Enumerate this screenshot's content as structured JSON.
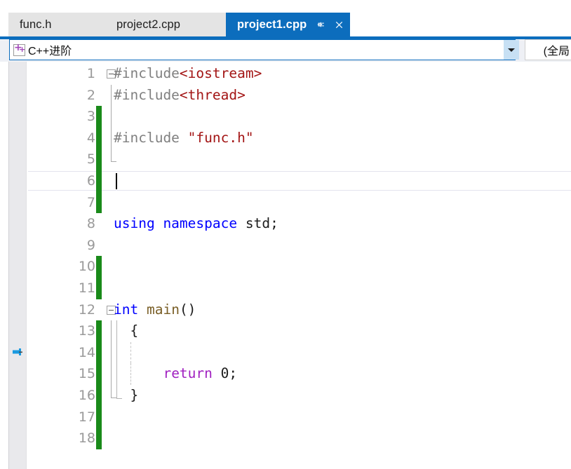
{
  "window": {
    "app": "Visual Studio",
    "accent_color": "#0c6dbd"
  },
  "tabs": [
    {
      "label": "func.h",
      "active": false,
      "name": "tab-func-h"
    },
    {
      "label": "project2.cpp",
      "active": false,
      "name": "tab-project2-cpp"
    },
    {
      "label": "project1.cpp",
      "active": true,
      "name": "tab-project1-cpp"
    }
  ],
  "tab_controls": {
    "pin_icon": "pin-icon",
    "close_icon": "close-icon"
  },
  "nav_bar": {
    "project_icon": "cpp-project-icon",
    "project_value": "C++进阶",
    "dropdown_icon": "chevron-down-icon",
    "scope_value": "(全局"
  },
  "editor": {
    "language": "cpp",
    "current_line": 6,
    "bookmark_line": 14,
    "bookmark_icon": "bookmark-pin-icon",
    "colors": {
      "preprocessor": "#808080",
      "string": "#a31515",
      "keyword": "#0000ff",
      "function": "#795e26",
      "control": "#a020c0",
      "plain": "#1b1b1b",
      "change_bar": "#1a8a1a",
      "line_number": "#9a9a9a"
    },
    "lines": [
      {
        "n": 1,
        "changed": false,
        "collapse": "open",
        "outline": "none",
        "tokens": [
          {
            "t": "#include",
            "c": "pre"
          },
          {
            "t": "<iostream>",
            "c": "str"
          }
        ]
      },
      {
        "n": 2,
        "changed": false,
        "collapse": "none",
        "outline": "v",
        "tokens": [
          {
            "t": "#include",
            "c": "pre"
          },
          {
            "t": "<thread>",
            "c": "str"
          }
        ]
      },
      {
        "n": 3,
        "changed": true,
        "collapse": "none",
        "outline": "v",
        "tokens": []
      },
      {
        "n": 4,
        "changed": true,
        "collapse": "none",
        "outline": "v",
        "tokens": [
          {
            "t": "#include ",
            "c": "pre"
          },
          {
            "t": "\"func.h\"",
            "c": "str"
          }
        ]
      },
      {
        "n": 5,
        "changed": true,
        "collapse": "none",
        "outline": "end",
        "tokens": []
      },
      {
        "n": 6,
        "changed": true,
        "collapse": "none",
        "outline": "none",
        "tokens": []
      },
      {
        "n": 7,
        "changed": true,
        "collapse": "none",
        "outline": "none",
        "tokens": []
      },
      {
        "n": 8,
        "changed": false,
        "collapse": "none",
        "outline": "none",
        "tokens": [
          {
            "t": "using namespace ",
            "c": "key"
          },
          {
            "t": "std;",
            "c": "plain"
          }
        ]
      },
      {
        "n": 9,
        "changed": false,
        "collapse": "none",
        "outline": "none",
        "tokens": []
      },
      {
        "n": 10,
        "changed": true,
        "collapse": "none",
        "outline": "none",
        "tokens": []
      },
      {
        "n": 11,
        "changed": true,
        "collapse": "none",
        "outline": "none",
        "tokens": []
      },
      {
        "n": 12,
        "changed": false,
        "collapse": "open",
        "outline": "none",
        "tokens": [
          {
            "t": "int ",
            "c": "key"
          },
          {
            "t": "main",
            "c": "fn"
          },
          {
            "t": "()",
            "c": "plain"
          }
        ]
      },
      {
        "n": 13,
        "changed": true,
        "collapse": "none",
        "outline": "v",
        "brace": "v",
        "tokens": [
          {
            "t": "  {",
            "c": "plain"
          }
        ]
      },
      {
        "n": 14,
        "changed": true,
        "collapse": "none",
        "outline": "v",
        "brace": "v",
        "indent": true,
        "tokens": []
      },
      {
        "n": 15,
        "changed": true,
        "collapse": "none",
        "outline": "v",
        "brace": "v",
        "indent": true,
        "tokens": [
          {
            "t": "      ",
            "c": "plain"
          },
          {
            "t": "return ",
            "c": "ctl"
          },
          {
            "t": "0;",
            "c": "plain"
          }
        ]
      },
      {
        "n": 16,
        "changed": true,
        "collapse": "none",
        "outline": "end",
        "brace": "end",
        "tokens": [
          {
            "t": "  }",
            "c": "plain"
          }
        ]
      },
      {
        "n": 17,
        "changed": true,
        "collapse": "none",
        "outline": "none",
        "tokens": []
      },
      {
        "n": 18,
        "changed": true,
        "collapse": "none",
        "outline": "none",
        "tokens": []
      }
    ]
  }
}
